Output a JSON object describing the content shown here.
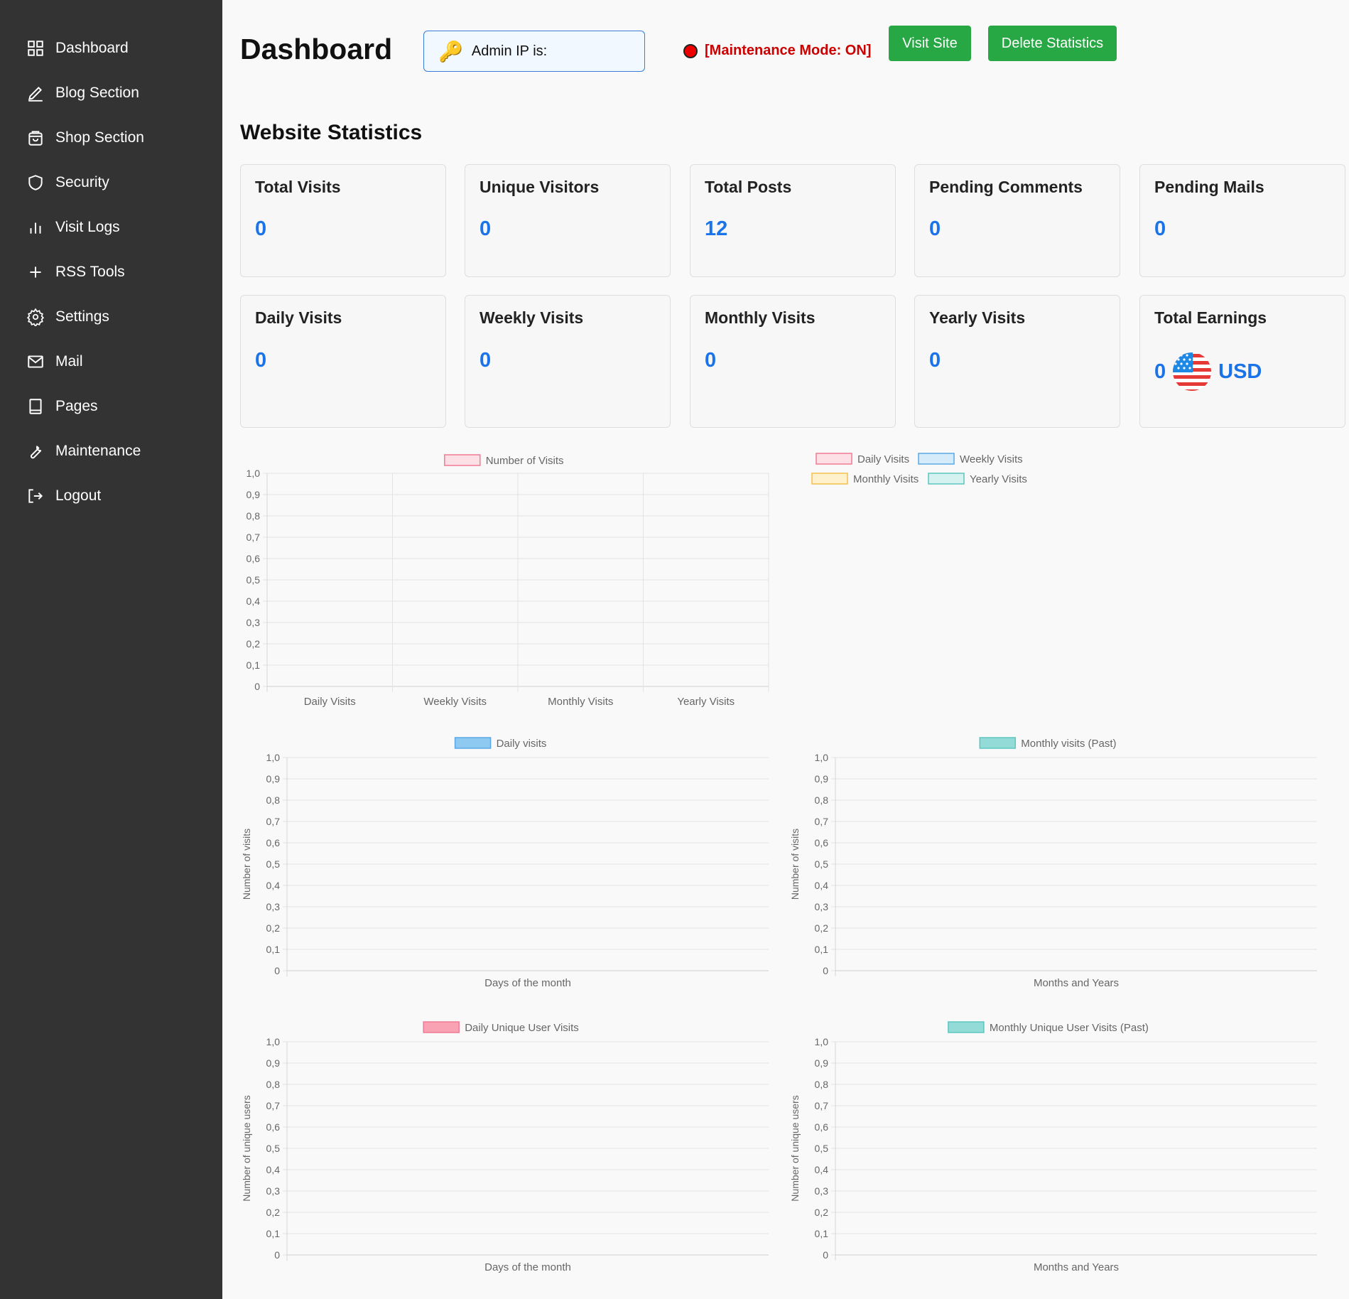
{
  "sidebar": {
    "items": [
      {
        "label": "Dashboard",
        "icon": "dashboard-grid-icon"
      },
      {
        "label": "Blog Section",
        "icon": "pencil-icon"
      },
      {
        "label": "Shop Section",
        "icon": "shopping-bag-icon"
      },
      {
        "label": "Security",
        "icon": "shield-icon"
      },
      {
        "label": "Visit Logs",
        "icon": "bar-chart-icon"
      },
      {
        "label": "RSS Tools",
        "icon": "plus-icon"
      },
      {
        "label": "Settings",
        "icon": "gear-icon"
      },
      {
        "label": "Mail",
        "icon": "envelope-icon"
      },
      {
        "label": "Pages",
        "icon": "book-icon"
      },
      {
        "label": "Maintenance",
        "icon": "wrench-icon"
      },
      {
        "label": "Logout",
        "icon": "logout-icon"
      }
    ]
  },
  "header": {
    "title": "Dashboard",
    "admin_ip_label": "Admin IP is:",
    "maintenance_status": "[Maintenance Mode: ON]",
    "visit_site_label": "Visit Site",
    "delete_statistics_label": "Delete Statistics"
  },
  "stats": {
    "title": "Website Statistics",
    "cards_row1": [
      {
        "title": "Total Visits",
        "value": "0"
      },
      {
        "title": "Unique Visitors",
        "value": "0"
      },
      {
        "title": "Total Posts",
        "value": "12"
      },
      {
        "title": "Pending Comments",
        "value": "0"
      },
      {
        "title": "Pending Mails",
        "value": "0"
      }
    ],
    "cards_row2": [
      {
        "title": "Daily Visits",
        "value": "0"
      },
      {
        "title": "Weekly Visits",
        "value": "0"
      },
      {
        "title": "Monthly Visits",
        "value": "0"
      },
      {
        "title": "Yearly Visits",
        "value": "0"
      }
    ],
    "earnings": {
      "title": "Total Earnings",
      "value": "0",
      "currency": "USD",
      "icon": "us-flag-icon"
    }
  },
  "colors": {
    "sidebar_bg": "#333333",
    "accent_green": "#28a745",
    "value_blue": "#1a73e8",
    "maintenance_red": "#cc0000"
  },
  "chart_data": [
    {
      "type": "bar",
      "legend": [
        {
          "label": "Number of Visits",
          "fill": "#fde0e6",
          "stroke": "#f07b93"
        }
      ],
      "categories": [
        "Daily Visits",
        "Weekly Visits",
        "Monthly Visits",
        "Yearly Visits"
      ],
      "values": [
        0,
        0,
        0,
        0
      ],
      "ylim": [
        0,
        1
      ],
      "yticks": [
        "1,0",
        "0,9",
        "0,8",
        "0,7",
        "0,6",
        "0,5",
        "0,4",
        "0,3",
        "0,2",
        "0,1",
        "0"
      ],
      "xlabel": "",
      "ylabel": "",
      "grid": true
    },
    {
      "type": "pie",
      "legend": [
        {
          "label": "Daily Visits",
          "fill": "#fde0e6",
          "stroke": "#f07b93"
        },
        {
          "label": "Weekly Visits",
          "fill": "#d6ebfa",
          "stroke": "#5aa9e6"
        },
        {
          "label": "Monthly Visits",
          "fill": "#fff1cc",
          "stroke": "#f5c04a"
        },
        {
          "label": "Yearly Visits",
          "fill": "#d6f2f0",
          "stroke": "#5cc6c0"
        }
      ],
      "values": [
        0,
        0,
        0,
        0
      ]
    },
    {
      "type": "bar",
      "legend": [
        {
          "label": "Daily visits",
          "fill": "#8ec9f2",
          "stroke": "#5aa9e6"
        }
      ],
      "categories": [],
      "values": [],
      "ylim": [
        0,
        1
      ],
      "yticks": [
        "1,0",
        "0,9",
        "0,8",
        "0,7",
        "0,6",
        "0,5",
        "0,4",
        "0,3",
        "0,2",
        "0,1",
        "0"
      ],
      "xlabel": "Days of the month",
      "ylabel": "Number of visits",
      "grid": true
    },
    {
      "type": "bar",
      "legend": [
        {
          "label": "Monthly visits (Past)",
          "fill": "#93dbd6",
          "stroke": "#5cc6c0"
        }
      ],
      "categories": [],
      "values": [],
      "ylim": [
        0,
        1
      ],
      "yticks": [
        "1,0",
        "0,9",
        "0,8",
        "0,7",
        "0,6",
        "0,5",
        "0,4",
        "0,3",
        "0,2",
        "0,1",
        "0"
      ],
      "xlabel": "Months and Years",
      "ylabel": "Number of visits",
      "grid": true
    },
    {
      "type": "bar",
      "legend": [
        {
          "label": "Daily Unique User Visits",
          "fill": "#f9a2b4",
          "stroke": "#f07b93"
        }
      ],
      "categories": [],
      "values": [],
      "ylim": [
        0,
        1
      ],
      "yticks": [
        "1,0",
        "0,9",
        "0,8",
        "0,7",
        "0,6",
        "0,5",
        "0,4",
        "0,3",
        "0,2",
        "0,1",
        "0"
      ],
      "xlabel": "Days of the month",
      "ylabel": "Number of unique users",
      "grid": true
    },
    {
      "type": "bar",
      "legend": [
        {
          "label": "Monthly Unique User Visits (Past)",
          "fill": "#93dbd6",
          "stroke": "#5cc6c0"
        }
      ],
      "categories": [],
      "values": [],
      "ylim": [
        0,
        1
      ],
      "yticks": [
        "1,0",
        "0,9",
        "0,8",
        "0,7",
        "0,6",
        "0,5",
        "0,4",
        "0,3",
        "0,2",
        "0,1",
        "0"
      ],
      "xlabel": "Months and Years",
      "ylabel": "Number of unique users",
      "grid": true
    }
  ]
}
